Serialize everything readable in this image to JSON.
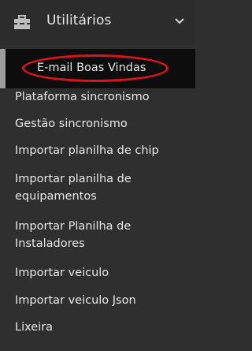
{
  "header": {
    "title": "Utilitários",
    "icon": "toolbox-icon",
    "chevron": "chevron-down-icon"
  },
  "menu": {
    "items": [
      {
        "label": "E-mail Boas Vindas",
        "active": true
      },
      {
        "label": "Plataforma sincronismo"
      },
      {
        "label": "Gestão sincronismo"
      },
      {
        "label": "Importar planilha de chip"
      },
      {
        "label": "Importar planilha de equipamentos"
      },
      {
        "label": "Importar Planilha de Instaladores"
      },
      {
        "label": "Importar veiculo"
      },
      {
        "label": "Importar veiculo Json"
      },
      {
        "label": "Lixeira"
      }
    ]
  },
  "colors": {
    "background": "#2f2f2f",
    "active_background": "#0d0d0d",
    "annotation": "#e0131d"
  }
}
